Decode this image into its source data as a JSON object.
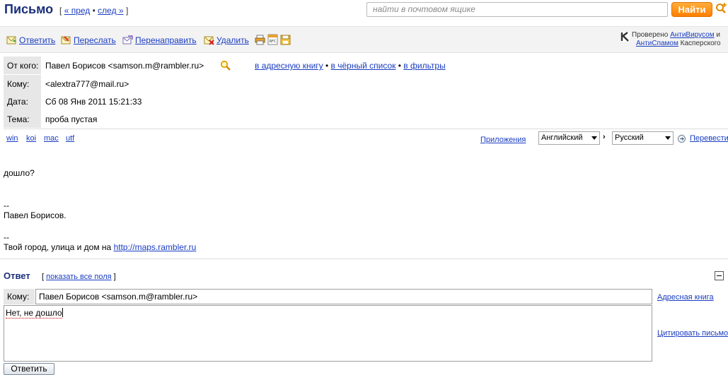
{
  "header": {
    "title": "Письмо",
    "nav_open": "[",
    "prev": "« пред",
    "dot": "•",
    "next": "след »",
    "nav_close": "]",
    "search_placeholder": "найти в почтовом ящике",
    "find_label": "Найти"
  },
  "toolbar": {
    "reply": "Ответить",
    "forward": "Переслать",
    "redirect": "Перенаправить",
    "delete": "Удалить",
    "kaspersky_checked": "Проверено",
    "kaspersky_antivirus": "АнтиВирусом",
    "kaspersky_and": "и",
    "kaspersky_antispam": "АнтиСпамом",
    "kaspersky_name": "Касперского"
  },
  "message_headers": {
    "from_label": "От кого:",
    "from_value": "Павел Борисов <samson.m@rambler.ru>",
    "to_label": "Кому:",
    "to_value": "<alextra777@mail.ru>",
    "date_label": "Дата:",
    "date_value": "Сб 08 Янв 2011 15:21:33",
    "subject_label": "Тема:",
    "subject_value": "проба пустая",
    "add_to_addressbook": "в адресную книгу",
    "blacklist": "в чёрный список",
    "filters": "в фильтры",
    "dot": "•"
  },
  "encodings": [
    "win",
    "koi",
    "mac",
    "utf"
  ],
  "attachments_label": "Приложения",
  "translate": {
    "from_lang": "Английский",
    "to_lang": "Русский",
    "arrow": "›",
    "button": "Перевести"
  },
  "body": {
    "line1": "дошло?",
    "sig_dash1": "--",
    "sig_name": "Павел Борисов.",
    "sig_dash2": "--",
    "ad_text": "Твой город, улица и дом на ",
    "ad_link": "http://maps.rambler.ru"
  },
  "reply": {
    "title": "Ответ",
    "fields_open": "[",
    "show_all_fields": "показать все поля",
    "fields_close": "]",
    "to_label": "Кому:",
    "to_value": "Павел Борисов <samson.m@rambler.ru>",
    "address_book": "Адресная книга",
    "message": "Нет, не дошло",
    "quote": "Цитировать письмо",
    "send": "Ответить"
  }
}
